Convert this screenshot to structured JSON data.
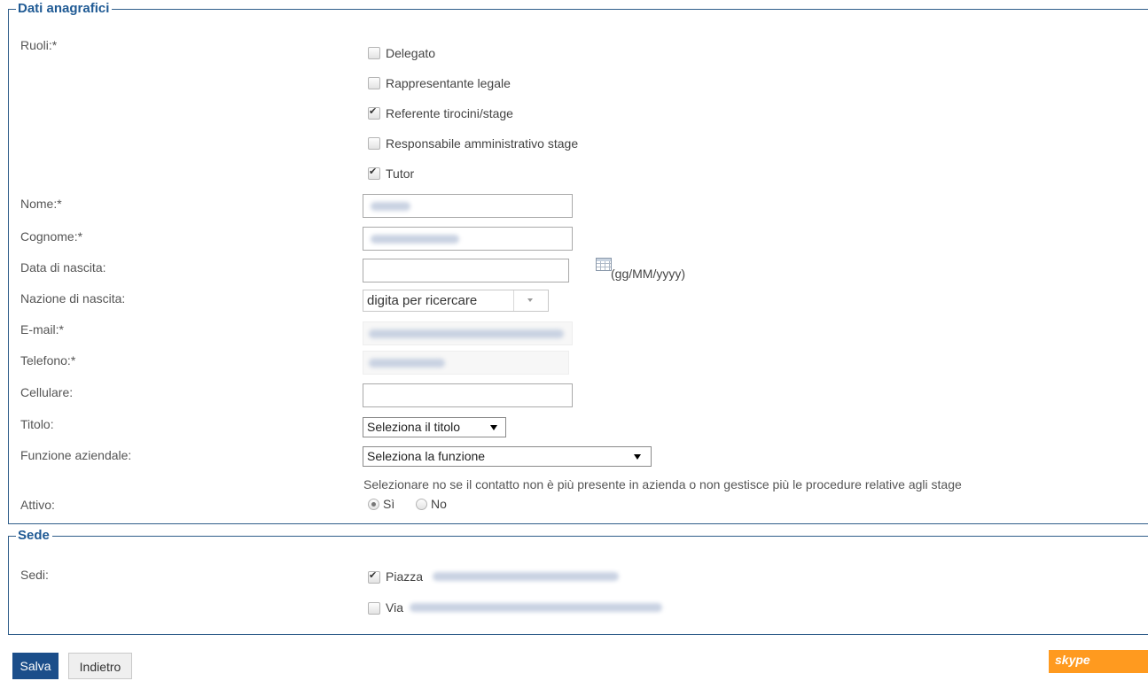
{
  "dati": {
    "legend": "Dati anagrafici",
    "ruoli_label": "Ruoli:*",
    "ruoli": [
      {
        "label": "Delegato",
        "checked": false
      },
      {
        "label": "Rappresentante legale",
        "checked": false
      },
      {
        "label": "Referente tirocini/stage",
        "checked": true
      },
      {
        "label": "Responsabile amministrativo stage",
        "checked": false
      },
      {
        "label": "Tutor",
        "checked": true
      }
    ],
    "nome_label": "Nome:*",
    "cognome_label": "Cognome:*",
    "data_nascita_label": "Data di nascita:",
    "data_format": "(gg/MM/yyyy)",
    "nazione_label": "Nazione di nascita:",
    "nazione_placeholder": "digita per ricercare",
    "email_label": "E-mail:*",
    "telefono_label": "Telefono:*",
    "cellulare_label": "Cellulare:",
    "titolo_label": "Titolo:",
    "titolo_value": "Seleziona il titolo",
    "funzione_label": "Funzione aziendale:",
    "funzione_value": "Seleziona la funzione",
    "attivo_hint": "Selezionare no se il contatto non è più presente in azienda o non gestisce più le procedure relative agli stage",
    "attivo_label": "Attivo:",
    "attivo_si": "Sì",
    "attivo_no": "No",
    "attivo_selected": "si"
  },
  "sede": {
    "legend": "Sede",
    "sedi_label": "Sedi:",
    "sedi": [
      {
        "label": "Piazza",
        "checked": true
      },
      {
        "label": "Via",
        "checked": false
      }
    ]
  },
  "buttons": {
    "salva": "Salva",
    "indietro": "Indietro"
  },
  "skype_label": "skype",
  "colors": {
    "accent": "#1f5a94",
    "salva_bg": "#1b4e8a",
    "skype_bg": "#ff9a1f"
  }
}
